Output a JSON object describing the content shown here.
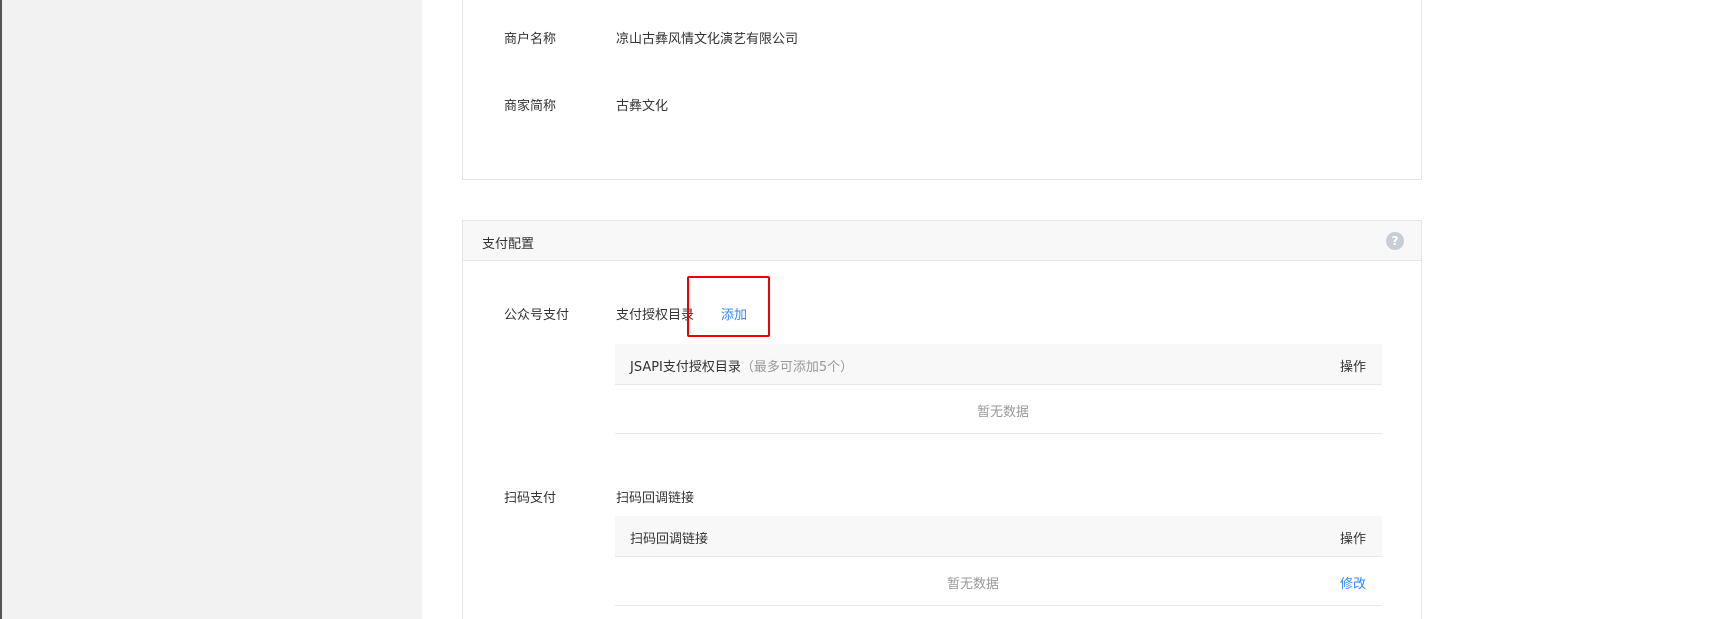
{
  "merchant_info": {
    "merchant_name_label": "商户名称",
    "merchant_name_value": "凉山古彝风情文化演艺有限公司",
    "merchant_short_label": "商家简称",
    "merchant_short_value": "古彝文化"
  },
  "payment_config": {
    "title": "支付配置",
    "help_icon": "?",
    "official_account": {
      "label": "公众号支付",
      "dir_label": "支付授权目录",
      "add_link": "添加",
      "table": {
        "col_main": "JSAPI支付授权目录",
        "col_hint": "（最多可添加5个）",
        "col_action": "操作",
        "empty_text": "暂无数据"
      }
    },
    "scan_pay": {
      "label": "扫码支付",
      "callback_label": "扫码回调链接",
      "table": {
        "col_main": "扫码回调链接",
        "col_action": "操作",
        "empty_text": "暂无数据",
        "edit_link": "修改"
      }
    }
  },
  "colors": {
    "link": "#3388ff",
    "highlight": "#ee0000"
  }
}
